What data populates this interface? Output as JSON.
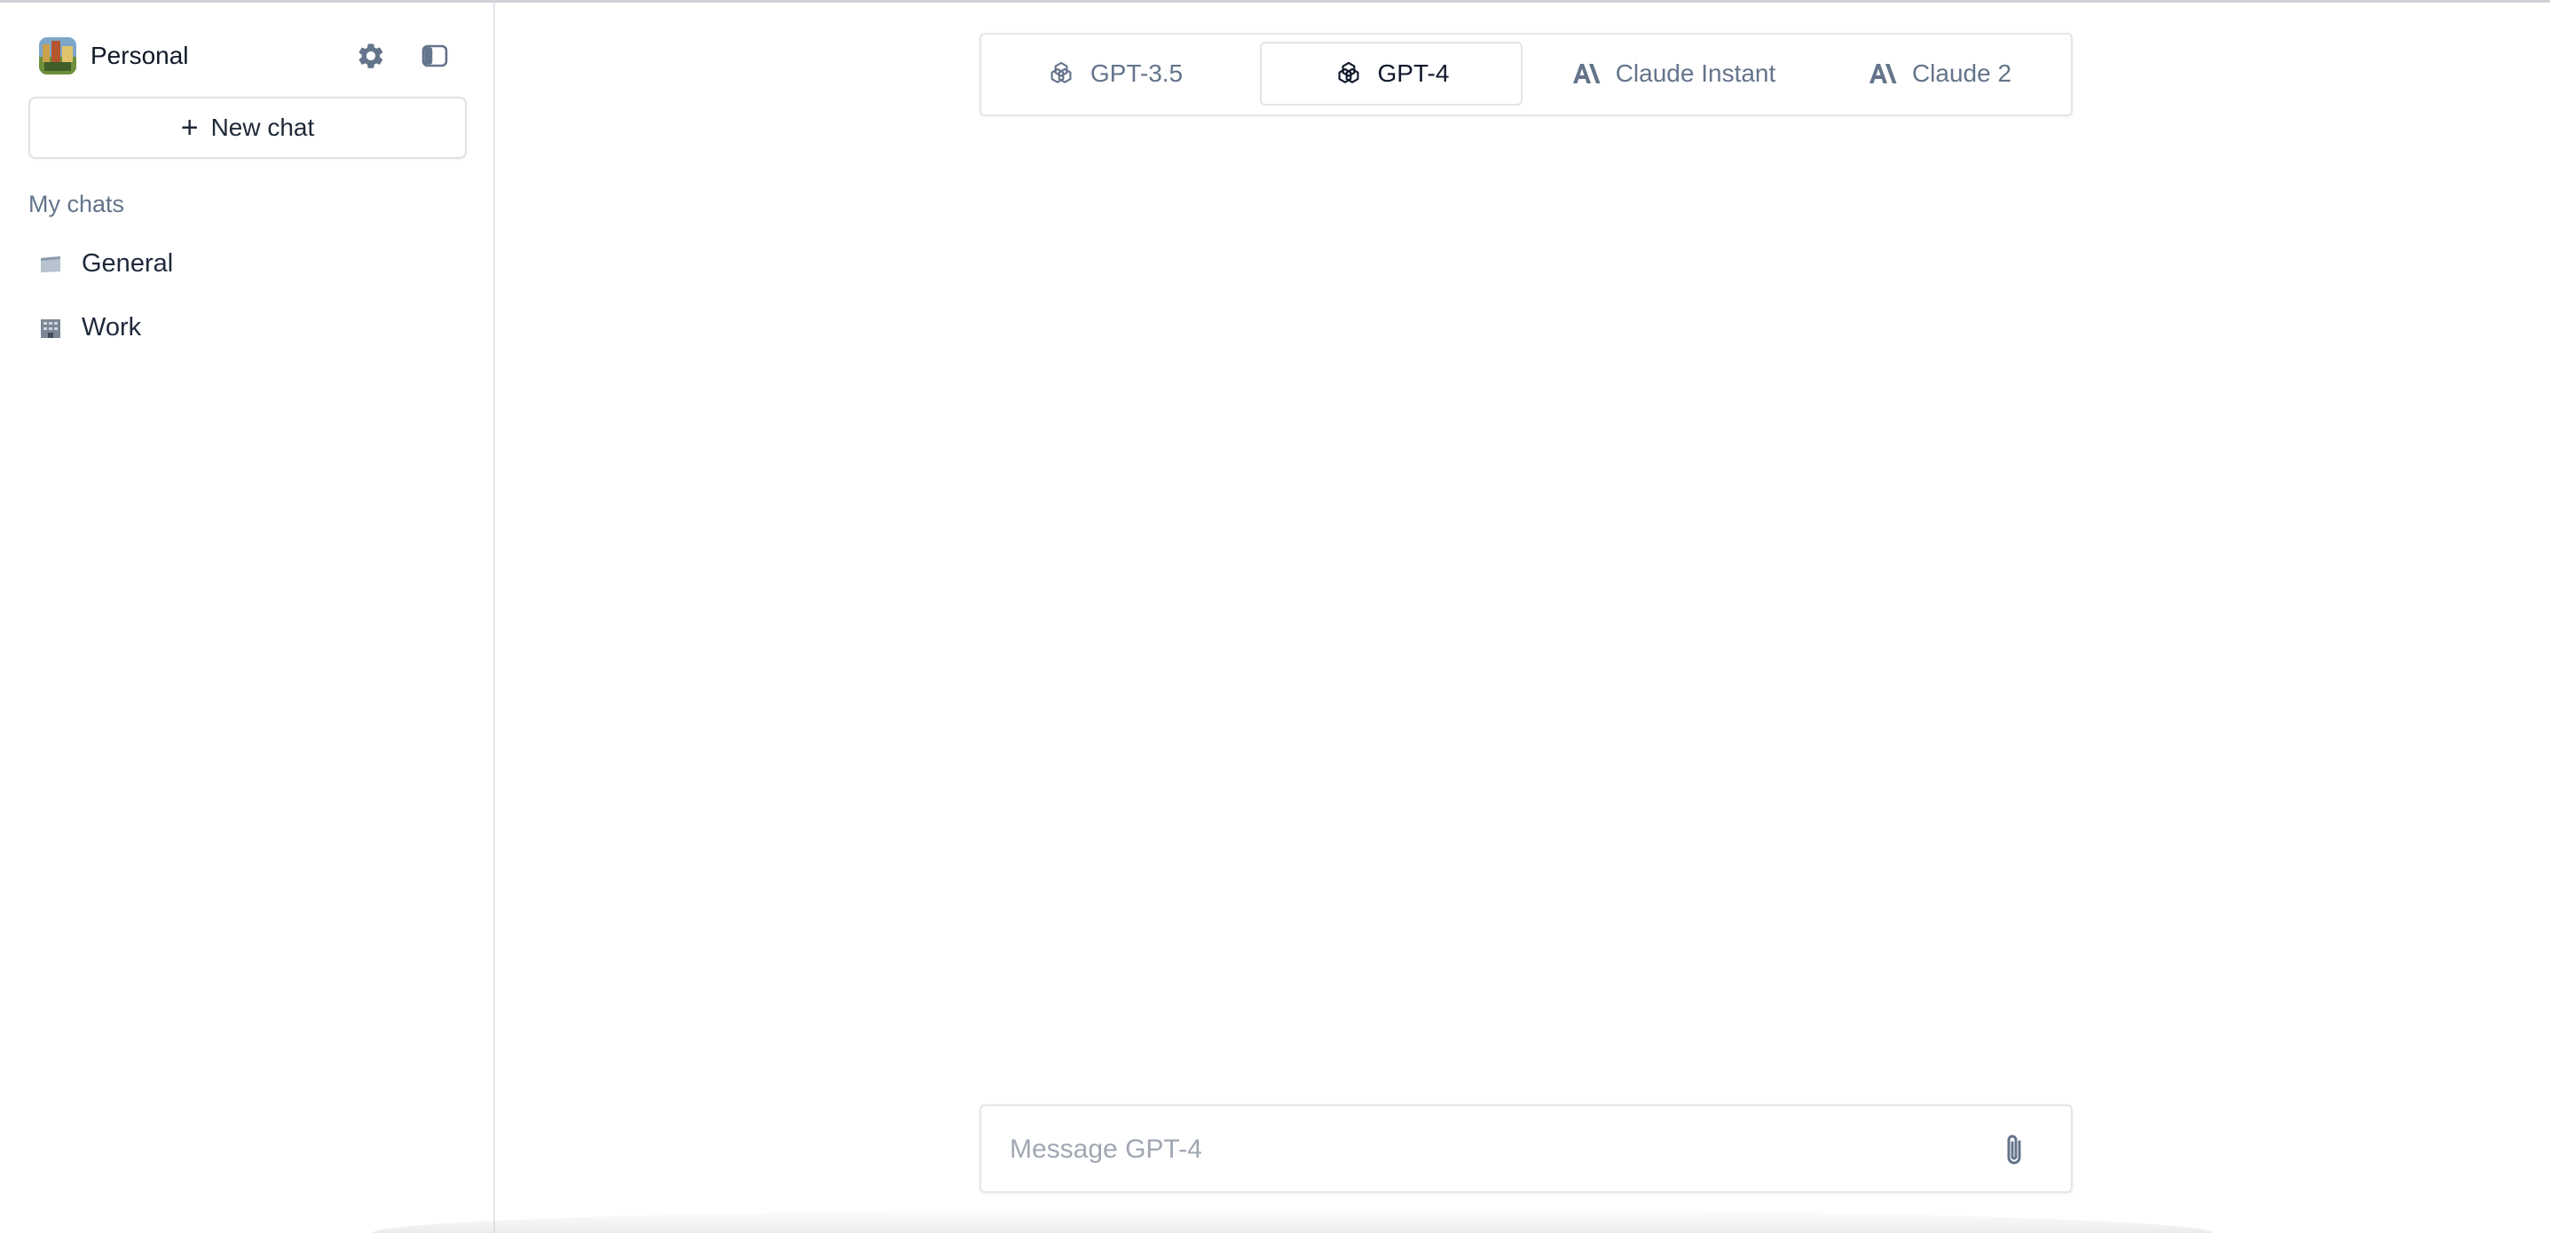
{
  "sidebar": {
    "workspace": {
      "name": "Personal",
      "avatar_icon": "workspace-avatar-image"
    },
    "settings_icon": "gear-icon",
    "toggle_icon": "sidebar-toggle-icon",
    "new_chat_label": "New chat",
    "section_label": "My chats",
    "folders": [
      {
        "label": "General",
        "icon": "folder-icon"
      },
      {
        "label": "Work",
        "icon": "building-icon"
      }
    ]
  },
  "model_tabs": [
    {
      "label": "GPT-3.5",
      "icon": "openai-icon",
      "active": false
    },
    {
      "label": "GPT-4",
      "icon": "openai-icon",
      "active": true
    },
    {
      "label": "Claude Instant",
      "icon": "anthropic-icon",
      "active": false
    },
    {
      "label": "Claude 2",
      "icon": "anthropic-icon",
      "active": false
    }
  ],
  "composer": {
    "placeholder": "Message GPT-4",
    "value": "",
    "attach_icon": "paperclip-icon"
  },
  "colors": {
    "muted_text": "#64748b",
    "border": "#e3e6ea",
    "active_text": "#0f172a"
  }
}
